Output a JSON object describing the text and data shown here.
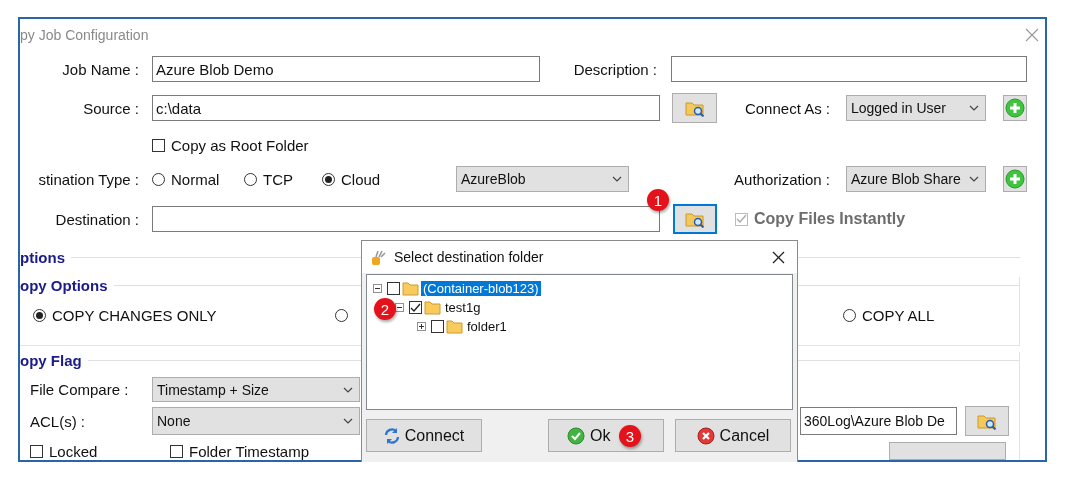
{
  "window": {
    "title": "py Job Configuration"
  },
  "form": {
    "job_name": {
      "label": "Job Name :",
      "value": "Azure Blob Demo"
    },
    "description": {
      "label": "Description :"
    },
    "source": {
      "label": "Source :",
      "value": "c:\\data"
    },
    "connect_as": {
      "label": "Connect As :",
      "value": "Logged in User"
    },
    "copy_as_root": {
      "label": "Copy as Root Folder",
      "checked": false
    },
    "destination_type": {
      "label": "stination Type :",
      "options": [
        {
          "label": "Normal",
          "selected": false
        },
        {
          "label": "TCP",
          "selected": false
        },
        {
          "label": "Cloud",
          "selected": true
        }
      ],
      "provider": "AzureBlob"
    },
    "authorization": {
      "label": "Authorization :",
      "value": "Azure Blob Share"
    },
    "destination": {
      "label": "Destination :",
      "browse_focused": true
    },
    "copy_files_instantly": {
      "label": "Copy Files Instantly",
      "checked": true,
      "disabled": true
    }
  },
  "options": {
    "title": "ptions",
    "copy_options": {
      "title": "opy Options",
      "choices": [
        {
          "label": "COPY CHANGES ONLY",
          "selected": true
        },
        {
          "selected": false
        },
        {
          "label": "COPY ALL",
          "selected": false
        }
      ]
    },
    "copy_flag": {
      "title": "opy Flag",
      "file_compare": {
        "label": "File Compare :",
        "value": "Timestamp + Size"
      },
      "acl": {
        "label": "ACL(s) :",
        "value": "None"
      },
      "log_path": {
        "value": "360Log\\Azure Blob De"
      },
      "flags": [
        {
          "label": "Locked",
          "checked": false
        },
        {
          "label": "Folder Timestamp",
          "checked": false
        }
      ]
    }
  },
  "dialog": {
    "title": "Select destination folder",
    "tree": [
      {
        "label": "(Container-blob123)",
        "checked": false,
        "expanded": true,
        "selected": true,
        "children": [
          {
            "label": "test1g",
            "checked": true,
            "expanded": true,
            "selected": false,
            "children": [
              {
                "label": "folder1",
                "checked": false,
                "expanded": false,
                "selected": false
              }
            ]
          }
        ]
      }
    ],
    "buttons": [
      {
        "label": "Connect",
        "kind": "connect"
      },
      {
        "label": "Ok",
        "kind": "ok"
      },
      {
        "label": "Cancel",
        "kind": "cancel"
      }
    ]
  },
  "callouts": [
    "1",
    "2",
    "3"
  ]
}
